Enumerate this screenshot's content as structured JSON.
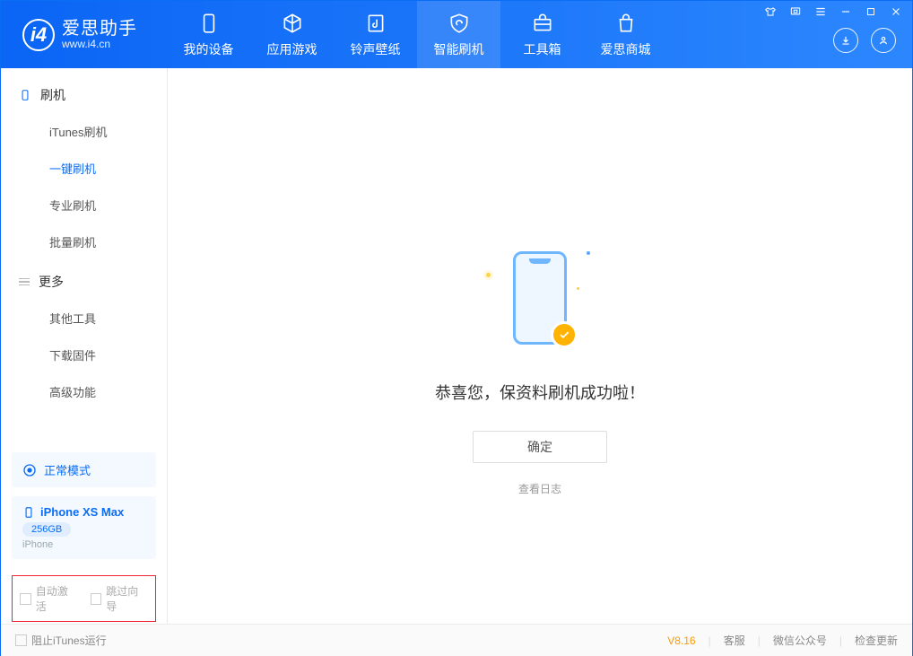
{
  "logo": {
    "cn": "爱思助手",
    "en": "www.i4.cn"
  },
  "nav": {
    "items": [
      {
        "label": "我的设备"
      },
      {
        "label": "应用游戏"
      },
      {
        "label": "铃声壁纸"
      },
      {
        "label": "智能刷机"
      },
      {
        "label": "工具箱"
      },
      {
        "label": "爱思商城"
      }
    ]
  },
  "sidebar": {
    "section1": {
      "title": "刷机",
      "items": [
        "iTunes刷机",
        "一键刷机",
        "专业刷机",
        "批量刷机"
      ],
      "activeIndex": 1
    },
    "section2": {
      "title": "更多",
      "items": [
        "其他工具",
        "下载固件",
        "高级功能"
      ]
    }
  },
  "mode": {
    "label": "正常模式"
  },
  "device": {
    "name": "iPhone XS Max",
    "capacity": "256GB",
    "type": "iPhone"
  },
  "options": {
    "auto_activate": "自动激活",
    "skip_wizard": "跳过向导"
  },
  "main": {
    "success_text": "恭喜您，保资料刷机成功啦！",
    "ok_label": "确定",
    "log_label": "查看日志"
  },
  "status": {
    "prevent_itunes": "阻止iTunes运行",
    "version": "V8.16",
    "links": [
      "客服",
      "微信公众号",
      "检查更新"
    ]
  }
}
